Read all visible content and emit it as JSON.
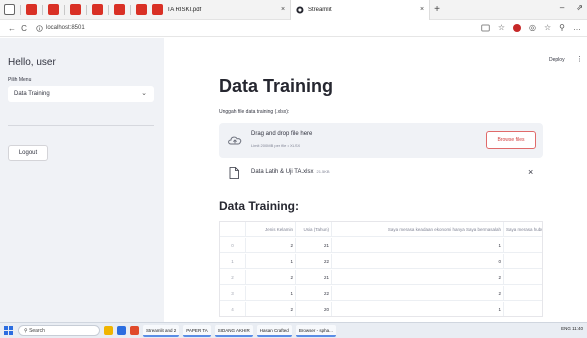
{
  "browser": {
    "tabs": [
      {
        "title": "TA RISKI.pdf",
        "close": "×"
      },
      {
        "title": "Streamlit",
        "close": "×",
        "active": true
      }
    ],
    "new_tab": "+",
    "controls": {
      "minimize": "–",
      "restore": "⇗"
    },
    "address": {
      "back": "←",
      "reload": "C",
      "url": "localhost:8501"
    }
  },
  "sidebar": {
    "greeting": "Hello, user",
    "menu_label": "Pilih Menu",
    "selected": "Data Training",
    "logout": "Logout"
  },
  "toolbar": {
    "deploy": "Deploy",
    "more": "⋮"
  },
  "main": {
    "title": "Data Training",
    "upload_label": "Unggah file data training (.xlsx):",
    "dropzone": {
      "main": "Drag and drop file here",
      "sub": "Limit 200MB per file • XLSX",
      "button": "Browse files"
    },
    "file": {
      "name": "Data Latih & Uji TA.xlsx",
      "size": "21.5KB",
      "remove": "×"
    },
    "section_title": "Data Training:",
    "table": {
      "columns": [
        "",
        "Jenis Kelamin",
        "Usia (Tahun)",
        "Saya merasa keadaan ekonomi hanya Saya bermasalah",
        "Saya merasa hubun"
      ],
      "rows": [
        [
          "0",
          "2",
          "21",
          "1",
          ""
        ],
        [
          "1",
          "1",
          "22",
          "0",
          ""
        ],
        [
          "2",
          "2",
          "21",
          "2",
          ""
        ],
        [
          "3",
          "1",
          "22",
          "2",
          ""
        ],
        [
          "4",
          "2",
          "20",
          "1",
          ""
        ]
      ]
    }
  },
  "taskbar": {
    "search": "Search",
    "items": [
      "Streamlit and 2",
      "PAPER TA",
      "SIDANG AKHIR",
      "Hasan Crafted",
      "Browser - spha..."
    ],
    "tray": "ENG  11:40"
  },
  "colors": {
    "accent": "#ff4b4b",
    "sidebar_bg": "#f0f2f6",
    "text": "#31333f"
  }
}
